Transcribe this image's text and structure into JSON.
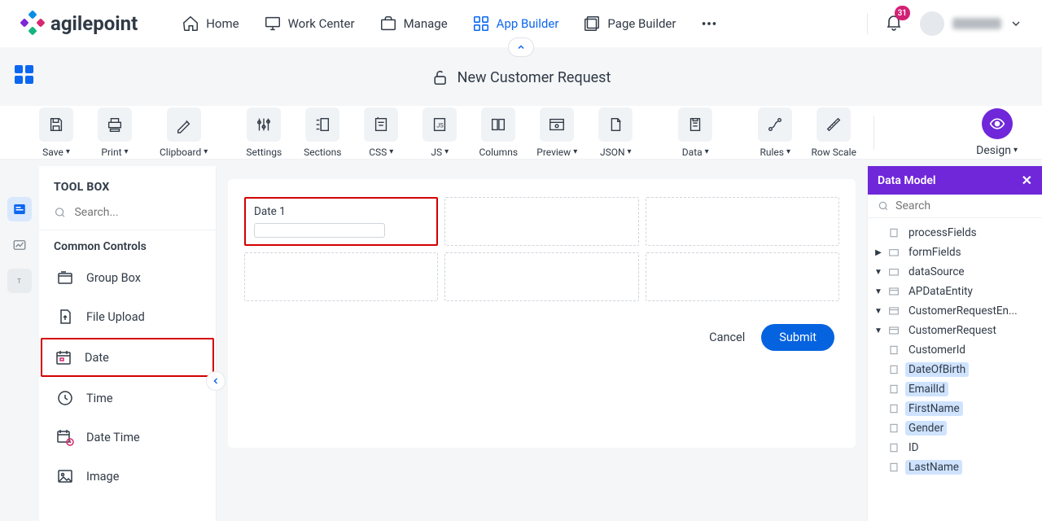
{
  "nav": {
    "logo_text": "agilepoint",
    "items": [
      {
        "id": "home",
        "label": "Home"
      },
      {
        "id": "workcenter",
        "label": "Work Center"
      },
      {
        "id": "manage",
        "label": "Manage"
      },
      {
        "id": "appbuilder",
        "label": "App Builder",
        "active": true
      },
      {
        "id": "pagebuilder",
        "label": "Page Builder"
      }
    ],
    "notification_count": "31"
  },
  "page": {
    "title": "New Customer Request"
  },
  "toolbar": {
    "save": "Save",
    "print": "Print",
    "clipboard": "Clipboard",
    "settings": "Settings",
    "sections": "Sections",
    "css": "CSS",
    "js": "JS",
    "columns": "Columns",
    "preview": "Preview",
    "json": "JSON",
    "data": "Data",
    "rules": "Rules",
    "rowscale": "Row Scale",
    "design": "Design"
  },
  "toolbox": {
    "header": "TOOL BOX",
    "search_placeholder": "Search...",
    "section": "Common Controls",
    "items": [
      {
        "id": "groupbox",
        "label": "Group Box"
      },
      {
        "id": "fileupload",
        "label": "File Upload"
      },
      {
        "id": "date",
        "label": "Date",
        "highlighted": true
      },
      {
        "id": "time",
        "label": "Time"
      },
      {
        "id": "datetime",
        "label": "Date Time"
      },
      {
        "id": "image",
        "label": "Image"
      }
    ]
  },
  "canvas": {
    "field_label": "Date 1",
    "actions": {
      "cancel": "Cancel",
      "submit": "Submit"
    }
  },
  "datamodel": {
    "title": "Data Model",
    "search_placeholder": "Search",
    "tree": {
      "processFields": "processFields",
      "formFields": "formFields",
      "dataSource": "dataSource",
      "apDataEntity": "APDataEntity",
      "customerRequestEn": "CustomerRequestEn...",
      "customerRequest": "CustomerRequest",
      "leaves": [
        {
          "label": "CustomerId",
          "hl": false
        },
        {
          "label": "DateOfBirth",
          "hl": true
        },
        {
          "label": "EmailId",
          "hl": true
        },
        {
          "label": "FirstName",
          "hl": true
        },
        {
          "label": "Gender",
          "hl": true
        },
        {
          "label": "ID",
          "hl": false
        },
        {
          "label": "LastName",
          "hl": true
        }
      ]
    }
  }
}
